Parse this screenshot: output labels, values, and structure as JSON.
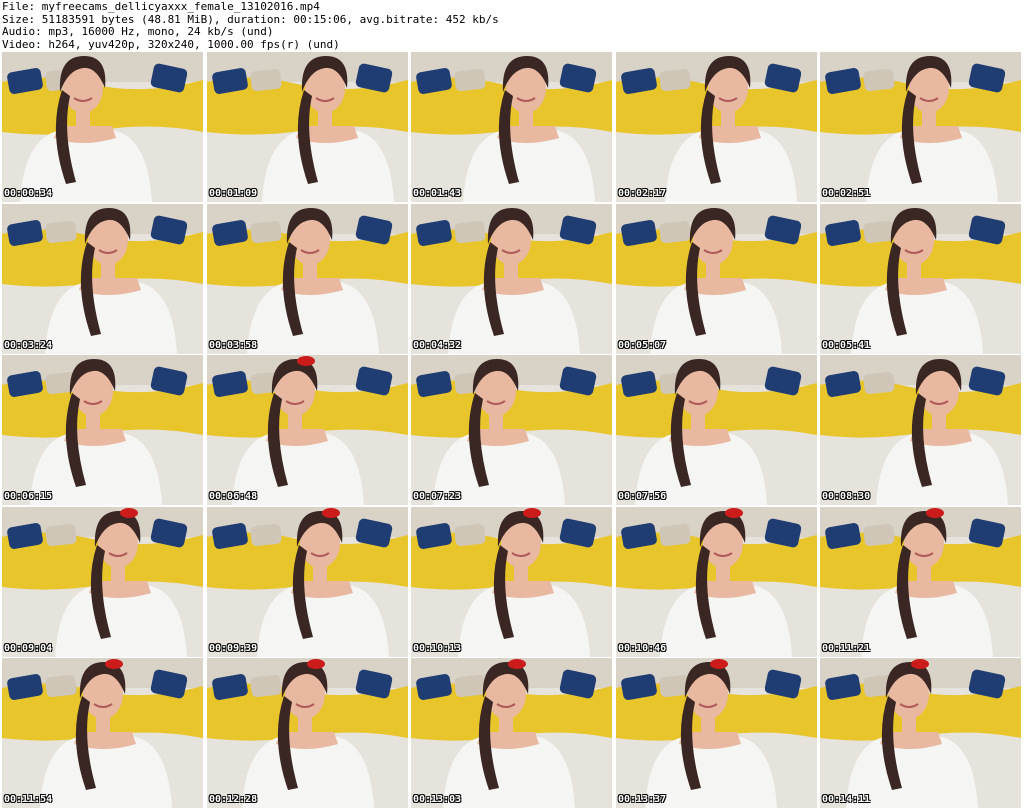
{
  "header": {
    "file_line": "File: myfreecams_dellicyaxxx_female_13102016.mp4",
    "size_line": "Size: 51183591 bytes (48.81 MiB), duration: 00:15:06, avg.bitrate: 452 kb/s",
    "audio_line": "Audio: mp3, 16000 Hz, mono, 24 kb/s (und)",
    "video_line": "Video: h264, yuv420p, 320x240, 1000.00 fps(r) (und)"
  },
  "colors": {
    "sofa": "#d9d2c6",
    "blanket": "#e8c52a",
    "pillow": "#1f3d73",
    "hair": "#3a2622",
    "skin": "#e8b8a0",
    "shirt": "#f5f5f3",
    "floor": "#e6e2dc",
    "bow": "#cc1b1b"
  },
  "thumbnails": [
    {
      "timestamp": "00:00:34"
    },
    {
      "timestamp": "00:01:09"
    },
    {
      "timestamp": "00:01:43"
    },
    {
      "timestamp": "00:02:17"
    },
    {
      "timestamp": "00:02:51"
    },
    {
      "timestamp": "00:03:24"
    },
    {
      "timestamp": "00:03:58"
    },
    {
      "timestamp": "00:04:32"
    },
    {
      "timestamp": "00:05:07"
    },
    {
      "timestamp": "00:05:41"
    },
    {
      "timestamp": "00:06:15"
    },
    {
      "timestamp": "00:06:48"
    },
    {
      "timestamp": "00:07:23"
    },
    {
      "timestamp": "00:07:56"
    },
    {
      "timestamp": "00:08:30"
    },
    {
      "timestamp": "00:09:04"
    },
    {
      "timestamp": "00:09:39"
    },
    {
      "timestamp": "00:10:13"
    },
    {
      "timestamp": "00:10:46"
    },
    {
      "timestamp": "00:11:21"
    },
    {
      "timestamp": "00:11:54"
    },
    {
      "timestamp": "00:12:28"
    },
    {
      "timestamp": "00:13:03"
    },
    {
      "timestamp": "00:13:37"
    },
    {
      "timestamp": "00:14:11"
    }
  ]
}
